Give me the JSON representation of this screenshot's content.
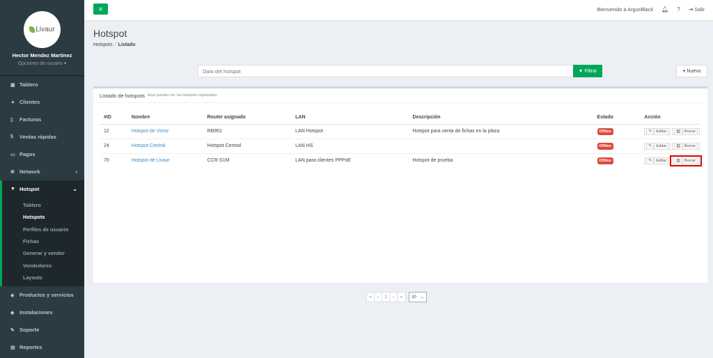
{
  "sidebar": {
    "logo": "Livaur",
    "user_name": "Hector Mendez Martinez",
    "user_options": "Opciones de usuario ▾",
    "items": [
      {
        "label": "Tablero",
        "icon": "dashboard-icon",
        "glyph": "🅐"
      },
      {
        "label": "Clientes",
        "icon": "users-icon",
        "glyph": "👥"
      },
      {
        "label": "Facturas",
        "icon": "invoice-icon",
        "glyph": "🗋"
      },
      {
        "label": "Ventas rápidas",
        "icon": "dollar-icon",
        "glyph": "$"
      },
      {
        "label": "Pagos",
        "icon": "money-icon",
        "glyph": "▭"
      },
      {
        "label": "Network",
        "icon": "network-icon",
        "glyph": "✻"
      },
      {
        "label": "Hotspot",
        "icon": "wifi-icon",
        "glyph": "◆"
      }
    ],
    "hotspot_submenu": [
      "Tablero",
      "Hotspots",
      "Perfiles de usuario",
      "Fichas",
      "Generar y vender",
      "Vendedores",
      "Layouts"
    ],
    "bottom_items": [
      {
        "label": "Productos y servicios",
        "icon": "tag-icon",
        "glyph": "◈"
      },
      {
        "label": "Instalaciones",
        "icon": "install-icon",
        "glyph": "◆"
      },
      {
        "label": "Soporte",
        "icon": "wrench-icon",
        "glyph": "🔧"
      },
      {
        "label": "Reportes",
        "icon": "reports-icon",
        "glyph": "▤"
      }
    ]
  },
  "topbar": {
    "welcome": "Bienvenido a ArgusBlack",
    "logout": "Salir"
  },
  "header": {
    "title": "Hotspot",
    "crumb_1": "Hotspots",
    "crumb_2": "Listado"
  },
  "filter": {
    "placeholder": "Dato del hotspot",
    "filter_label": "Filtrar",
    "new_label": "Nuevo"
  },
  "box": {
    "title": "Listado de hotspots",
    "subtitle": "Aquí puedes ver los hotspots registrados"
  },
  "table": {
    "headers": [
      "#ID",
      "Nombre",
      "Router asignado",
      "LAN",
      "Descripción",
      "Estado",
      "Acción"
    ],
    "rows": [
      {
        "id": "12",
        "name": "Hotspot de Victor",
        "router": "RB951",
        "lan": "LAN Hotspot",
        "desc": "Hotspot para venta de fichas en la plaza",
        "status": "Offline"
      },
      {
        "id": "24",
        "name": "Hotspot Central",
        "router": "Hotspot Central",
        "lan": "LAN HS",
        "desc": "",
        "status": "Offline"
      },
      {
        "id": "70",
        "name": "Hotspot de Livaur",
        "router": "CCR-S1M",
        "lan": "LAN para clientes PPPoE",
        "desc": "Hotspot de prueba",
        "status": "Offline"
      }
    ],
    "edit_label": "Editar",
    "delete_label": "Borrar"
  },
  "pagination": {
    "first": "«",
    "prev": "‹",
    "page": "1",
    "next": "›",
    "last": "»",
    "per_page": "10"
  },
  "colors": {
    "accent": "#00a65a",
    "danger": "#dd4b39",
    "link": "#3c8dbc",
    "sidebar": "#2c3b41"
  }
}
